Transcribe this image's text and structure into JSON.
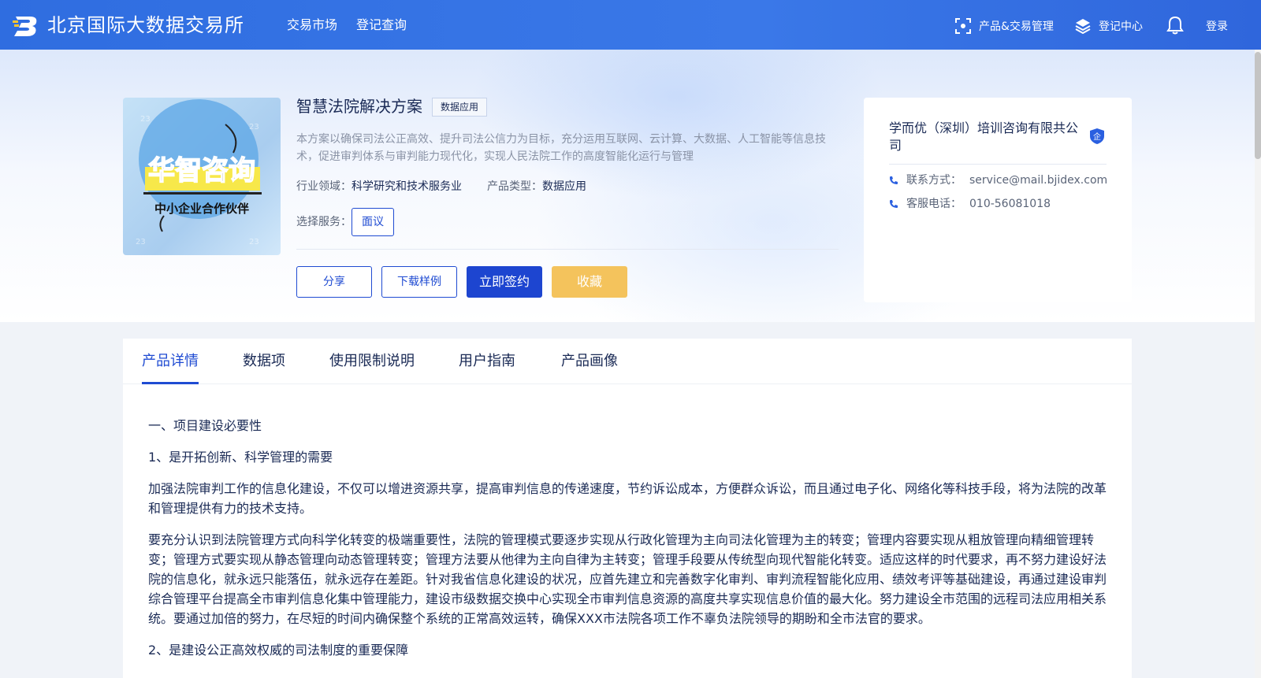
{
  "header": {
    "brand": "北京国际大数据交易所",
    "nav": [
      "交易市场",
      "登记查询"
    ],
    "product_mgmt": "产品&交易管理",
    "reg_center": "登记中心",
    "login": "登录"
  },
  "product": {
    "image_text": {
      "main": "华智咨询",
      "sub": "中小企业合作伙伴"
    },
    "title": "智慧法院解决方案",
    "tag": "数据应用",
    "description": "本方案以确保司法公正高效、提升司法公信力为目标，充分运用互联网、云计算、大数据、人工智能等信息技术，促进审判体系与审判能力现代化，实现人民法院工作的高度智能化运行与管理",
    "industry_label": "行业领域：",
    "industry_value": "科学研究和技术服务业",
    "type_label": "产品类型：",
    "type_value": "数据应用",
    "service_label": "选择服务：",
    "service_option": "面议",
    "buttons": {
      "share": "分享",
      "download": "下载样例",
      "sign": "立即签约",
      "favorite": "收藏"
    }
  },
  "company": {
    "name": "学而优（深圳）培训咨询有限共公司",
    "badge": "企",
    "contact_label": "联系方式：",
    "contact_value": "service@mail.bjidex.com",
    "phone_label": "客服电话：",
    "phone_value": "010-56081018"
  },
  "tabs": [
    "产品详情",
    "数据项",
    "使用限制说明",
    "用户指南",
    "产品画像"
  ],
  "active_tab": "产品详情",
  "detail": {
    "h1": "一、项目建设必要性",
    "h2": "1、是开拓创新、科学管理的需要",
    "p1": "加强法院审判工作的信息化建设，不仅可以增进资源共享，提高审判信息的传递速度，节约诉讼成本，方便群众诉讼，而且通过电子化、网络化等科技手段，将为法院的改革和管理提供有力的技术支持。",
    "p2": "要充分认识到法院管理方式向科学化转变的极端重要性，法院的管理模式要逐步实现从行政化管理为主向司法化管理为主的转变；管理内容要实现从粗放管理向精细管理转变；管理方式要实现从静态管理向动态管理转变；管理方法要从他律为主向自律为主转变；管理手段要从传统型向现代智能化转变。适应这样的时代要求，再不努力建设好法院的信息化，就永远只能落伍，就永远存在差距。针对我省信息化建设的状况，应首先建立和完善数字化审判、审判流程智能化应用、绩效考评等基础建设，再通过建设审判综合管理平台提高全市审判信息化集中管理能力，建设市级数据交换中心实现全市审判信息资源的高度共享实现信息价值的最大化。努力建设全市范围的远程司法应用相关系统。要通过加倍的努力，在尽短的时间内确保整个系统的正常高效运转，确保XXX市法院各项工作不辜负法院领导的期盼和全市法官的要求。",
    "h3": "2、是建设公正高效权威的司法制度的重要保障"
  }
}
